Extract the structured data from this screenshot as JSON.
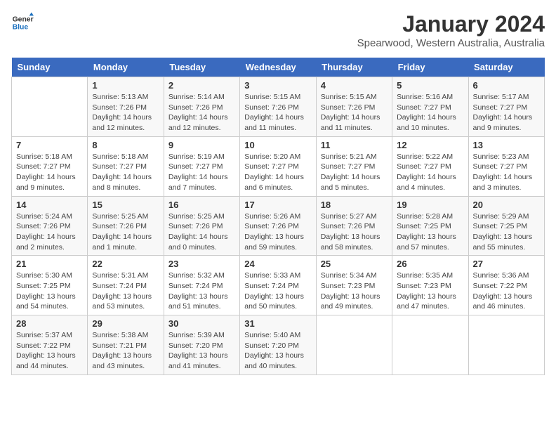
{
  "header": {
    "logo_line1": "General",
    "logo_line2": "Blue",
    "month_year": "January 2024",
    "location": "Spearwood, Western Australia, Australia"
  },
  "weekdays": [
    "Sunday",
    "Monday",
    "Tuesday",
    "Wednesday",
    "Thursday",
    "Friday",
    "Saturday"
  ],
  "weeks": [
    [
      {
        "day": "",
        "info": ""
      },
      {
        "day": "1",
        "info": "Sunrise: 5:13 AM\nSunset: 7:26 PM\nDaylight: 14 hours\nand 12 minutes."
      },
      {
        "day": "2",
        "info": "Sunrise: 5:14 AM\nSunset: 7:26 PM\nDaylight: 14 hours\nand 12 minutes."
      },
      {
        "day": "3",
        "info": "Sunrise: 5:15 AM\nSunset: 7:26 PM\nDaylight: 14 hours\nand 11 minutes."
      },
      {
        "day": "4",
        "info": "Sunrise: 5:15 AM\nSunset: 7:26 PM\nDaylight: 14 hours\nand 11 minutes."
      },
      {
        "day": "5",
        "info": "Sunrise: 5:16 AM\nSunset: 7:27 PM\nDaylight: 14 hours\nand 10 minutes."
      },
      {
        "day": "6",
        "info": "Sunrise: 5:17 AM\nSunset: 7:27 PM\nDaylight: 14 hours\nand 9 minutes."
      }
    ],
    [
      {
        "day": "7",
        "info": "Sunrise: 5:18 AM\nSunset: 7:27 PM\nDaylight: 14 hours\nand 9 minutes."
      },
      {
        "day": "8",
        "info": "Sunrise: 5:18 AM\nSunset: 7:27 PM\nDaylight: 14 hours\nand 8 minutes."
      },
      {
        "day": "9",
        "info": "Sunrise: 5:19 AM\nSunset: 7:27 PM\nDaylight: 14 hours\nand 7 minutes."
      },
      {
        "day": "10",
        "info": "Sunrise: 5:20 AM\nSunset: 7:27 PM\nDaylight: 14 hours\nand 6 minutes."
      },
      {
        "day": "11",
        "info": "Sunrise: 5:21 AM\nSunset: 7:27 PM\nDaylight: 14 hours\nand 5 minutes."
      },
      {
        "day": "12",
        "info": "Sunrise: 5:22 AM\nSunset: 7:27 PM\nDaylight: 14 hours\nand 4 minutes."
      },
      {
        "day": "13",
        "info": "Sunrise: 5:23 AM\nSunset: 7:27 PM\nDaylight: 14 hours\nand 3 minutes."
      }
    ],
    [
      {
        "day": "14",
        "info": "Sunrise: 5:24 AM\nSunset: 7:26 PM\nDaylight: 14 hours\nand 2 minutes."
      },
      {
        "day": "15",
        "info": "Sunrise: 5:25 AM\nSunset: 7:26 PM\nDaylight: 14 hours\nand 1 minute."
      },
      {
        "day": "16",
        "info": "Sunrise: 5:25 AM\nSunset: 7:26 PM\nDaylight: 14 hours\nand 0 minutes."
      },
      {
        "day": "17",
        "info": "Sunrise: 5:26 AM\nSunset: 7:26 PM\nDaylight: 13 hours\nand 59 minutes."
      },
      {
        "day": "18",
        "info": "Sunrise: 5:27 AM\nSunset: 7:26 PM\nDaylight: 13 hours\nand 58 minutes."
      },
      {
        "day": "19",
        "info": "Sunrise: 5:28 AM\nSunset: 7:25 PM\nDaylight: 13 hours\nand 57 minutes."
      },
      {
        "day": "20",
        "info": "Sunrise: 5:29 AM\nSunset: 7:25 PM\nDaylight: 13 hours\nand 55 minutes."
      }
    ],
    [
      {
        "day": "21",
        "info": "Sunrise: 5:30 AM\nSunset: 7:25 PM\nDaylight: 13 hours\nand 54 minutes."
      },
      {
        "day": "22",
        "info": "Sunrise: 5:31 AM\nSunset: 7:24 PM\nDaylight: 13 hours\nand 53 minutes."
      },
      {
        "day": "23",
        "info": "Sunrise: 5:32 AM\nSunset: 7:24 PM\nDaylight: 13 hours\nand 51 minutes."
      },
      {
        "day": "24",
        "info": "Sunrise: 5:33 AM\nSunset: 7:24 PM\nDaylight: 13 hours\nand 50 minutes."
      },
      {
        "day": "25",
        "info": "Sunrise: 5:34 AM\nSunset: 7:23 PM\nDaylight: 13 hours\nand 49 minutes."
      },
      {
        "day": "26",
        "info": "Sunrise: 5:35 AM\nSunset: 7:23 PM\nDaylight: 13 hours\nand 47 minutes."
      },
      {
        "day": "27",
        "info": "Sunrise: 5:36 AM\nSunset: 7:22 PM\nDaylight: 13 hours\nand 46 minutes."
      }
    ],
    [
      {
        "day": "28",
        "info": "Sunrise: 5:37 AM\nSunset: 7:22 PM\nDaylight: 13 hours\nand 44 minutes."
      },
      {
        "day": "29",
        "info": "Sunrise: 5:38 AM\nSunset: 7:21 PM\nDaylight: 13 hours\nand 43 minutes."
      },
      {
        "day": "30",
        "info": "Sunrise: 5:39 AM\nSunset: 7:20 PM\nDaylight: 13 hours\nand 41 minutes."
      },
      {
        "day": "31",
        "info": "Sunrise: 5:40 AM\nSunset: 7:20 PM\nDaylight: 13 hours\nand 40 minutes."
      },
      {
        "day": "",
        "info": ""
      },
      {
        "day": "",
        "info": ""
      },
      {
        "day": "",
        "info": ""
      }
    ]
  ]
}
